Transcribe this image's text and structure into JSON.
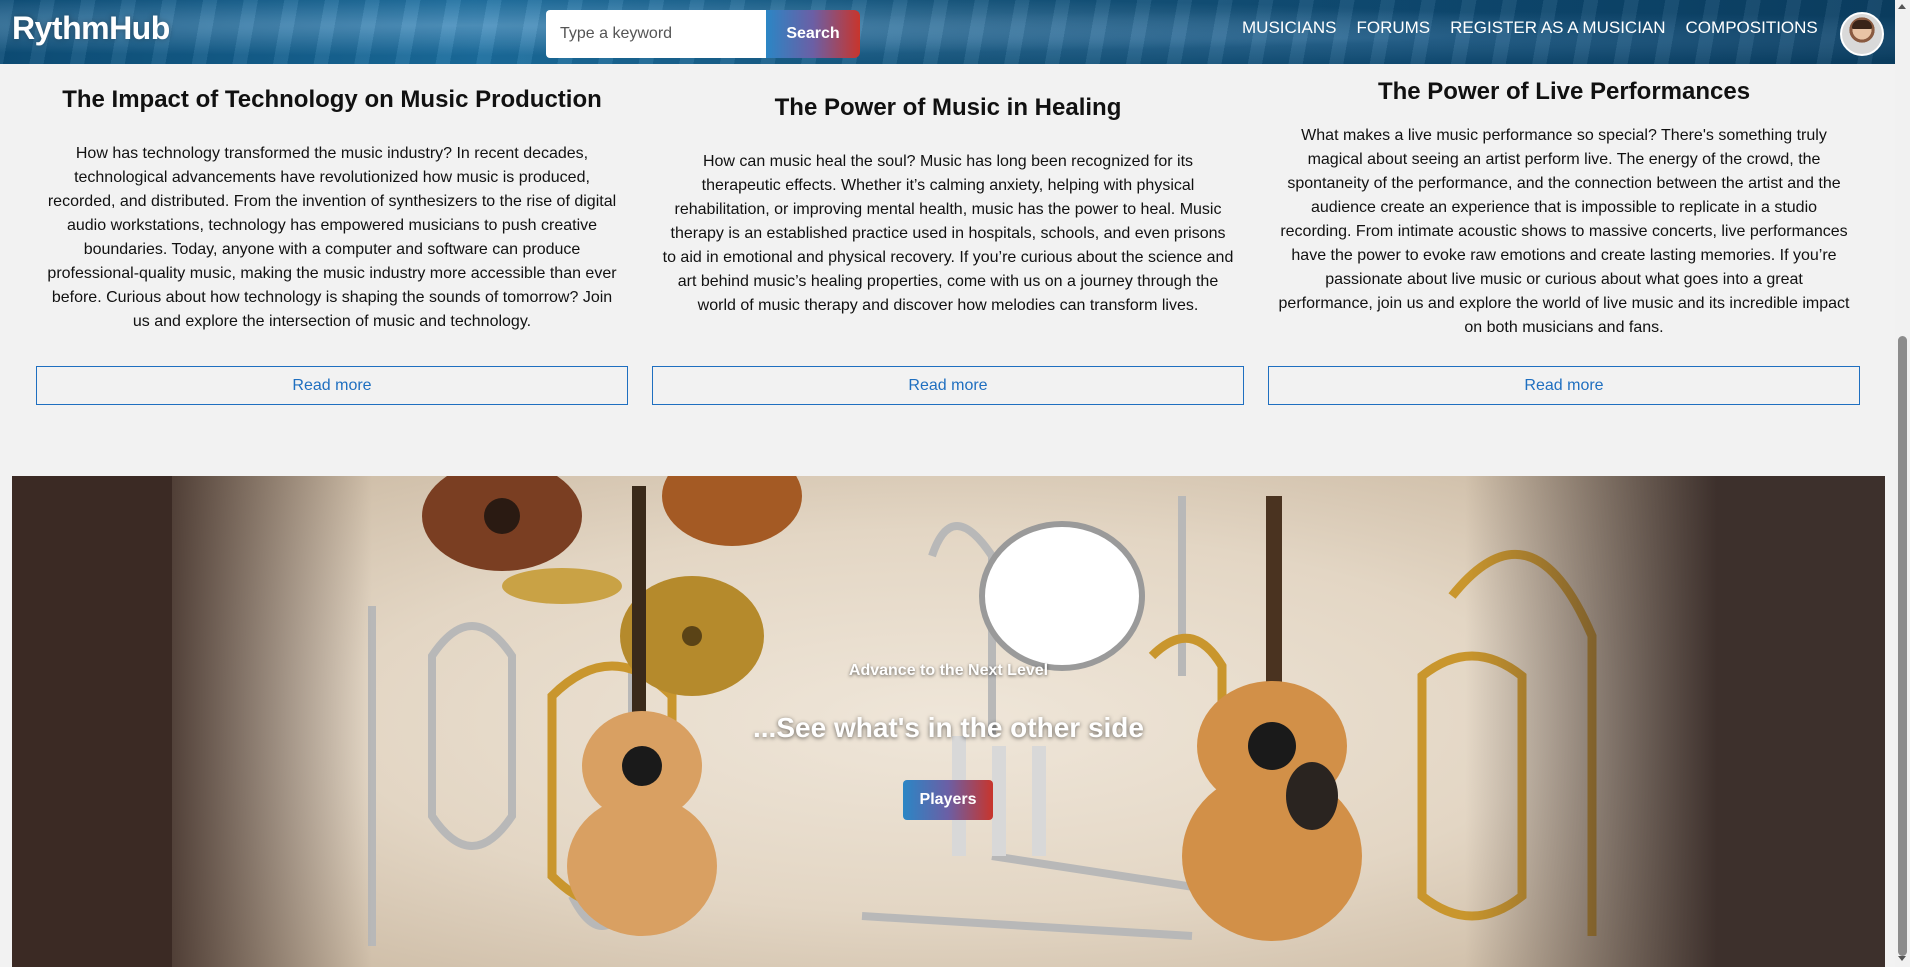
{
  "navbar": {
    "logo": "RythmHub",
    "search": {
      "placeholder": "Type a keyword",
      "button_label": "Search"
    },
    "links": [
      "MUSICIANS",
      "FORUMS",
      "REGISTER AS A MUSICIAN",
      "COMPOSITIONS"
    ]
  },
  "articles": [
    {
      "title": "The Impact of Technology on Music Production",
      "body": "How has technology transformed the music industry? In recent decades, technological advancements have revolutionized how music is produced, recorded, and distributed. From the invention of synthesizers to the rise of digital audio workstations, technology has empowered musicians to push creative boundaries. Today, anyone with a computer and software can produce professional-quality music, making the music industry more accessible than ever before. Curious about how technology is shaping the sounds of tomorrow? Join us and explore the intersection of music and technology.",
      "button": "Read more"
    },
    {
      "title": "The Power of Music in Healing",
      "body": "How can music heal the soul? Music has long been recognized for its therapeutic effects. Whether it’s calming anxiety, helping with physical rehabilitation, or improving mental health, music has the power to heal. Music therapy is an established practice used in hospitals, schools, and even prisons to aid in emotional and physical recovery. If you’re curious about the science and art behind music’s healing properties, come with us on a journey through the world of music therapy and discover how melodies can transform lives.",
      "button": "Read more"
    },
    {
      "title": "The Power of Live Performances",
      "body": "What makes a live music performance so special? There's something truly magical about seeing an artist perform live. The energy of the crowd, the spontaneity of the performance, and the connection between the artist and the audience create an experience that is impossible to replicate in a studio recording. From intimate acoustic shows to massive concerts, live performances have the power to evoke raw emotions and create lasting memories. If you’re passionate about live music or curious about what goes into a great performance, join us and explore the world of live music and its incredible impact on both musicians and fans.",
      "button": "Read more"
    }
  ],
  "hero": {
    "kicker": "Advance to the Next Level",
    "title": "...See what's in the other side",
    "button": "Players"
  },
  "colors": {
    "navbar": "#0d4e78",
    "accent_link": "#1f6fc0",
    "gradient_start": "#2b86c5",
    "gradient_end": "#c8352c"
  }
}
